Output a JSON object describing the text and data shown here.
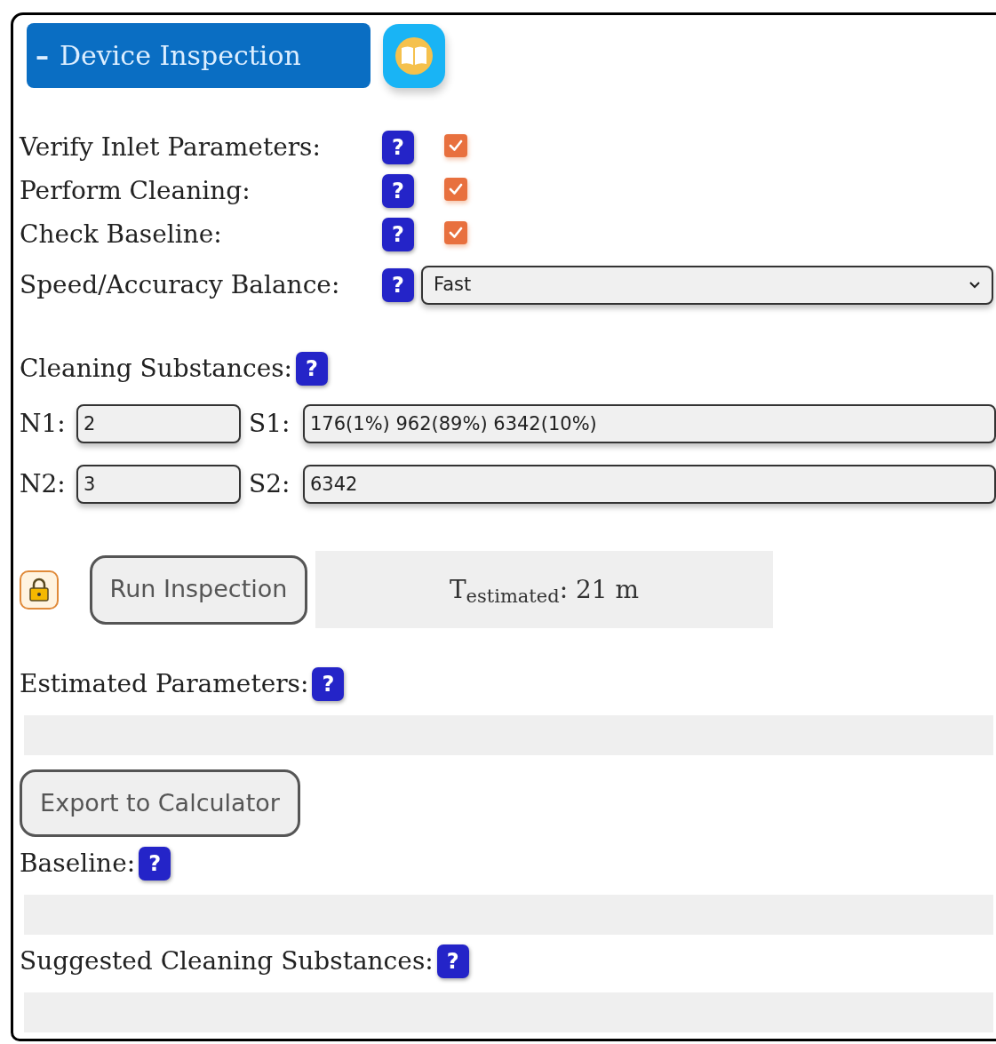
{
  "header": {
    "toggle": "–",
    "title": "Device Inspection"
  },
  "options": [
    {
      "kind": "checkbox",
      "label": "Verify Inlet Parameters:",
      "help": "?",
      "checked": true
    },
    {
      "kind": "checkbox",
      "label": "Perform Cleaning:",
      "help": "?",
      "checked": true
    },
    {
      "kind": "checkbox",
      "label": "Check Baseline:",
      "help": "?",
      "checked": true
    },
    {
      "kind": "select",
      "label": "Speed/Accuracy Balance:",
      "help": "?",
      "value": "Fast"
    }
  ],
  "cleaning_substances": {
    "label": "Cleaning Substances:",
    "help": "?",
    "rows": [
      {
        "n_label": "N1:",
        "n_value": "2",
        "s_label": "S1:",
        "s_value": "176(1%) 962(89%) 6342(10%)"
      },
      {
        "n_label": "N2:",
        "n_value": "3",
        "s_label": "S2:",
        "s_value": "6342"
      }
    ]
  },
  "run": {
    "button": "Run Inspection",
    "time": "T$_{estimated}$: 21 m"
  },
  "sections": [
    {
      "kind": "output",
      "label": "Estimated Parameters:",
      "help": "?"
    },
    {
      "kind": "button",
      "label": "Export to Calculator"
    },
    {
      "kind": "output",
      "label": "Baseline:",
      "help": "?"
    },
    {
      "kind": "output",
      "label": "Suggested Cleaning Substances:",
      "help": "?"
    }
  ]
}
